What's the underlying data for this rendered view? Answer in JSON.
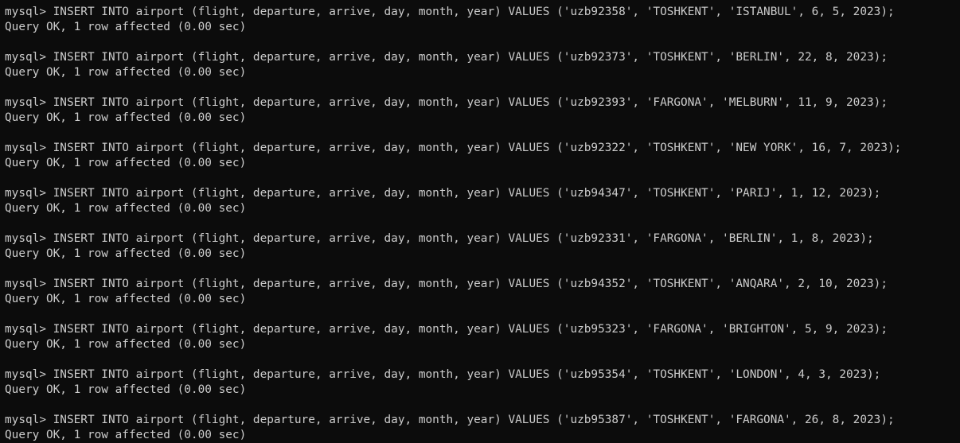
{
  "terminal": {
    "background": "#0c0c0c",
    "foreground": "#cccccc",
    "entries": [
      {
        "command": "mysql> INSERT INTO airport (flight, departure, arrive, day, month, year) VALUES ('uzb92358', 'TOSHKENT', 'ISTANBUL', 6, 5, 2023);",
        "result": "Query OK, 1 row affected (0.00 sec)"
      },
      {
        "command": "mysql> INSERT INTO airport (flight, departure, arrive, day, month, year) VALUES ('uzb92373', 'TOSHKENT', 'BERLIN', 22, 8, 2023);",
        "result": "Query OK, 1 row affected (0.00 sec)"
      },
      {
        "command": "mysql> INSERT INTO airport (flight, departure, arrive, day, month, year) VALUES ('uzb92393', 'FARGONA', 'MELBURN', 11, 9, 2023);",
        "result": "Query OK, 1 row affected (0.00 sec)"
      },
      {
        "command": "mysql> INSERT INTO airport (flight, departure, arrive, day, month, year) VALUES ('uzb92322', 'TOSHKENT', 'NEW YORK', 16, 7, 2023);",
        "result": "Query OK, 1 row affected (0.00 sec)"
      },
      {
        "command": "mysql> INSERT INTO airport (flight, departure, arrive, day, month, year) VALUES ('uzb94347', 'TOSHKENT', 'PARIJ', 1, 12, 2023);",
        "result": "Query OK, 1 row affected (0.00 sec)"
      },
      {
        "command": "mysql> INSERT INTO airport (flight, departure, arrive, day, month, year) VALUES ('uzb92331', 'FARGONA', 'BERLIN', 1, 8, 2023);",
        "result": "Query OK, 1 row affected (0.00 sec)"
      },
      {
        "command": "mysql> INSERT INTO airport (flight, departure, arrive, day, month, year) VALUES ('uzb94352', 'TOSHKENT', 'ANQARA', 2, 10, 2023);",
        "result": "Query OK, 1 row affected (0.00 sec)"
      },
      {
        "command": "mysql> INSERT INTO airport (flight, departure, arrive, day, month, year) VALUES ('uzb95323', 'FARGONA', 'BRIGHTON', 5, 9, 2023);",
        "result": "Query OK, 1 row affected (0.00 sec)"
      },
      {
        "command": "mysql> INSERT INTO airport (flight, departure, arrive, day, month, year) VALUES ('uzb95354', 'TOSHKENT', 'LONDON', 4, 3, 2023);",
        "result": "Query OK, 1 row affected (0.00 sec)"
      },
      {
        "command": "mysql> INSERT INTO airport (flight, departure, arrive, day, month, year) VALUES ('uzb95387', 'TOSHKENT', 'FARGONA', 26, 8, 2023);",
        "result": "Query OK, 1 row affected (0.00 sec)"
      }
    ]
  }
}
